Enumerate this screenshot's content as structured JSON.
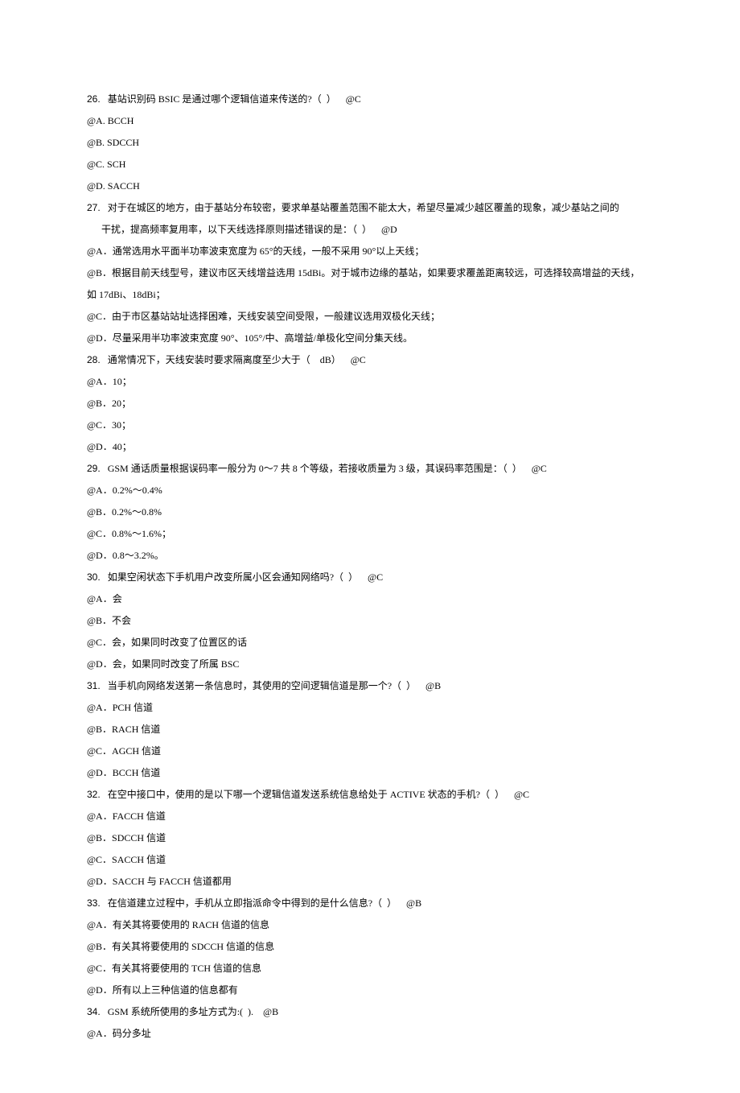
{
  "questions": [
    {
      "num": "26.",
      "text": "   基站识别码 BSIC 是通过哪个逻辑信道来传送的?（  ）    @C",
      "options": [
        "@A. BCCH",
        "@B. SDCCH",
        "@C. SCH",
        "@D. SACCH"
      ]
    },
    {
      "num": "27.",
      "text": "   对于在城区的地方，由于基站分布较密，要求单基站覆盖范围不能太大，希望尽量减少越区覆盖的现象，减少基站之间的",
      "cont": "干扰，提高频率复用率，以下天线选择原则描述错误的是：（  ）    @D",
      "options": [
        "@A．通常选用水平面半功率波束宽度为 65°的天线，一般不采用 90°以上天线；",
        "@B．根据目前天线型号，建议市区天线增益选用 15dBi。对于城市边缘的基站，如果要求覆盖距离较远，可选择较高增益的天线，",
        "如 17dBi、18dBi；",
        "@C．由于市区基站站址选择困难，天线安装空间受限，一般建议选用双极化天线；",
        "@D．尽量采用半功率波束宽度 90°、105°/中、高增益/单极化空间分集天线。"
      ]
    },
    {
      "num": "28.",
      "text": "   通常情况下，天线安装时要求隔离度至少大于（    dB）    @C",
      "options": [
        "@A．10；",
        "@B．20；",
        "@C．30；",
        "@D．40；"
      ]
    },
    {
      "num": "29.",
      "text": "   GSM 通话质量根据误码率一般分为 0～7 共 8 个等级，若接收质量为 3 级，其误码率范围是：（  ）    @C",
      "options": [
        "@A．0.2%～0.4%",
        "@B．0.2%～0.8%",
        "@C．0.8%～1.6%；",
        "@D．0.8～3.2%。"
      ]
    },
    {
      "num": "30.",
      "text": "   如果空闲状态下手机用户改变所属小区会通知网络吗?（  ）    @C",
      "options": [
        "@A．会",
        "@B．不会",
        "@C．会，如果同时改变了位置区的话",
        "@D．会，如果同时改变了所属 BSC"
      ]
    },
    {
      "num": "31.",
      "text": "   当手机向网络发送第一条信息时，其使用的空间逻辑信道是那一个?（  ）    @B",
      "options": [
        "@A．PCH 信道",
        "@B．RACH 信道",
        "@C．AGCH 信道",
        "@D．BCCH 信道"
      ]
    },
    {
      "num": "32.",
      "text": "   在空中接口中，使用的是以下哪一个逻辑信道发送系统信息给处于 ACTIVE 状态的手机?（  ）    @C",
      "options": [
        "@A．FACCH 信道",
        "@B．SDCCH 信道",
        "@C．SACCH 信道",
        "@D．SACCH 与 FACCH 信道都用"
      ]
    },
    {
      "num": "33.",
      "text": "   在信道建立过程中，手机从立即指派命令中得到的是什么信息?（  ）    @B",
      "options": [
        "@A．有关其将要使用的 RACH 信道的信息",
        "@B．有关其将要使用的 SDCCH 信道的信息",
        "@C．有关其将要使用的 TCH 信道的信息",
        "@D．所有以上三种信道的信息都有"
      ]
    },
    {
      "num": "34.",
      "text": "   GSM 系统所使用的多址方式为:(  ).    @B",
      "options": [
        "@A．码分多址"
      ]
    }
  ]
}
